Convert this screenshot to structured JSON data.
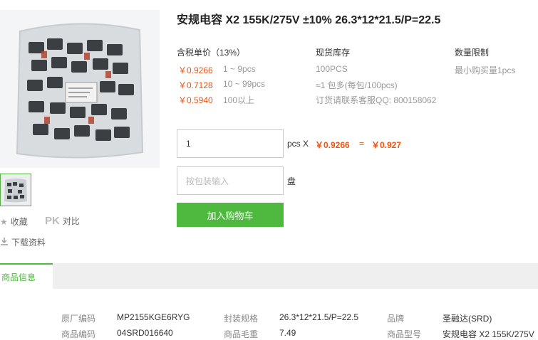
{
  "product": {
    "title": "安规电容 X2 155K/275V ±10% 26.3*12*21.5/P=22.5"
  },
  "pricing": {
    "header": "含税单价（13%）",
    "tiers": [
      {
        "price": "￥0.9266",
        "range": "1 ~ 9pcs"
      },
      {
        "price": "￥0.7128",
        "range": "10 ~ 99pcs"
      },
      {
        "price": "￥0.5940",
        "range": "100以上"
      }
    ]
  },
  "stock": {
    "header": "现货库存",
    "qty": "100PCS",
    "pack": "≈1 包多(每包/100pcs)",
    "contact": "订货请联系客服QQ: 800158062"
  },
  "limit": {
    "header": "数量限制",
    "min": "最小购买量1pcs"
  },
  "order": {
    "qty_value": "1",
    "unit_label": "pcs X",
    "unit_price": "￥0.9266",
    "equals": "=",
    "total": "￥0.927",
    "pack_placeholder": "按包装输入",
    "pack_unit": "盘",
    "add_to_cart": "加入购物车"
  },
  "side_actions": {
    "favorite": "收藏",
    "pk_badge": "PK",
    "compare": "对比",
    "download": "下载资料"
  },
  "tabs": {
    "active": "商品信息"
  },
  "specs": [
    {
      "label": "原厂编码",
      "value": "MP2155KGE6RYG"
    },
    {
      "label": "封装规格",
      "value": "26.3*12*21.5/P=22.5"
    },
    {
      "label": "品牌",
      "value": "圣融达(SRD)"
    },
    {
      "label": "商品编码",
      "value": "04SRD016640"
    },
    {
      "label": "商品毛重",
      "value": "7.49"
    },
    {
      "label": "商品型号",
      "value": "安规电容 X2 155K/275V"
    }
  ],
  "colors": {
    "accent_green": "#4fb83f",
    "price_orange": "#f3520f"
  }
}
